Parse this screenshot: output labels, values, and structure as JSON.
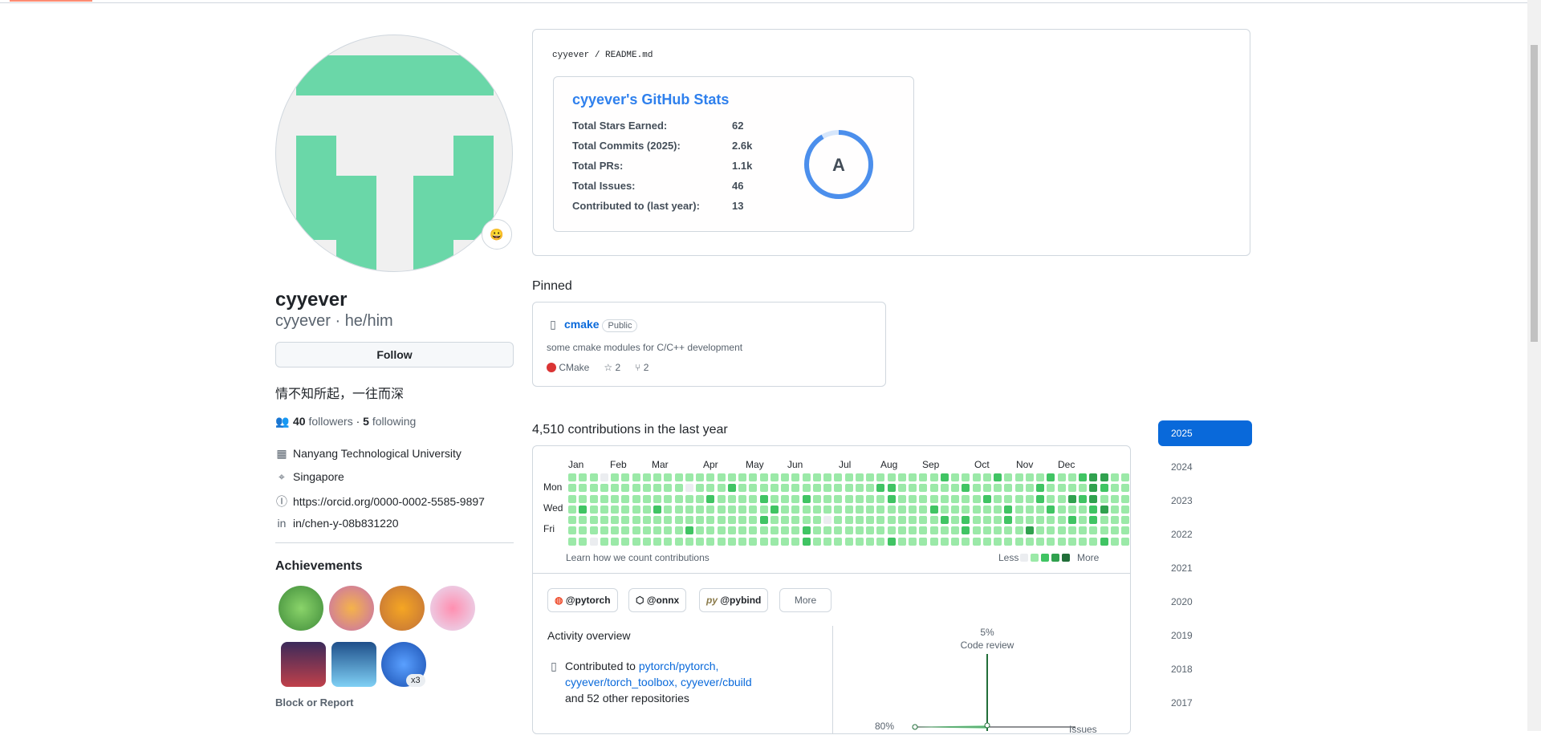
{
  "profile": {
    "name": "cyyever",
    "login": "cyyever",
    "pronouns": "he/him",
    "follow_label": "Follow",
    "bio": "情不知所起，一往而深",
    "followers": "40",
    "followers_label": "followers",
    "following": "5",
    "following_label": "following",
    "org": "Nanyang Technological University",
    "location": "Singapore",
    "orcid": "https://orcid.org/0000-0002-5585-9897",
    "linkedin": "in/chen-y-08b831220",
    "achievements_title": "Achievements",
    "achievement_multiplier": "x3",
    "block_label": "Block or Report",
    "status_emoji": "😀"
  },
  "readme": {
    "owner": "cyyever",
    "file": "README.md",
    "stats_title": "cyyever's GitHub Stats",
    "rows": [
      {
        "label": "Total Stars Earned:",
        "value": "62"
      },
      {
        "label": "Total Commits (2025):",
        "value": "2.6k"
      },
      {
        "label": "Total PRs:",
        "value": "1.1k"
      },
      {
        "label": "Total Issues:",
        "value": "46"
      },
      {
        "label": "Contributed to (last year):",
        "value": "13"
      }
    ],
    "grade": "A",
    "accent": "#2f80ed"
  },
  "pinned": {
    "title": "Pinned",
    "repo": "cmake",
    "visibility": "Public",
    "description": "some cmake modules for C/C++ development",
    "language": "CMake",
    "language_color": "#da3434",
    "stars": "2",
    "forks": "2"
  },
  "contrib": {
    "title": "4,510 contributions in the last year",
    "months": [
      "Jan",
      "Feb",
      "Mar",
      "Apr",
      "May",
      "Jun",
      "Jul",
      "Aug",
      "Sep",
      "Oct",
      "Nov",
      "Dec"
    ],
    "days": [
      "Mon",
      "Wed",
      "Fri"
    ],
    "learn": "Learn how we count contributions",
    "less": "Less",
    "more": "More",
    "colors": [
      "#ebedf0",
      "#9be9a8",
      "#40c463",
      "#30a14e",
      "#216e39"
    ],
    "weeks": [
      "1111111",
      "1112111",
      "1111110",
      "0111111",
      "1111111",
      "1111111",
      "1111111",
      "1111111",
      "1112111",
      "1111111",
      "1111111",
      "1011121",
      "1111111",
      "1121111",
      "1111111",
      "1211111",
      "1111111",
      "1111111",
      "1121211",
      "1112111",
      "1111111",
      "1111111",
      "1121122",
      "1111111",
      "1111011",
      "1111111",
      "1111111",
      "1111111",
      "1111111",
      "1211111",
      "1221112",
      "1111111",
      "1111111",
      "1111111",
      "1112111",
      "2111211",
      "1111111",
      "1211221",
      "1111111",
      "1121111",
      "2111111",
      "1112211",
      "1111111",
      "1111131",
      "1221111",
      "2112111",
      "1111111",
      "1131211",
      "2121111",
      "3332211",
      "3213112",
      "1111111",
      "1111111"
    ],
    "orgs": [
      "@pytorch",
      "@onnx",
      "@pybind"
    ],
    "more_label": "More",
    "activity_title": "Activity overview",
    "activity_prefix": "Contributed to",
    "activity_repos": [
      "pytorch/pytorch,",
      "cyyever/torch_toolbox,",
      "cyyever/cbuild"
    ],
    "activity_suffix": "and 52 other repositories",
    "code_review_pct": "5%",
    "code_review_label": "Code review",
    "commits_pct": "80%",
    "issues_label": "Issues"
  },
  "years": [
    "2025",
    "2024",
    "2023",
    "2022",
    "2021",
    "2020",
    "2019",
    "2018",
    "2017"
  ]
}
